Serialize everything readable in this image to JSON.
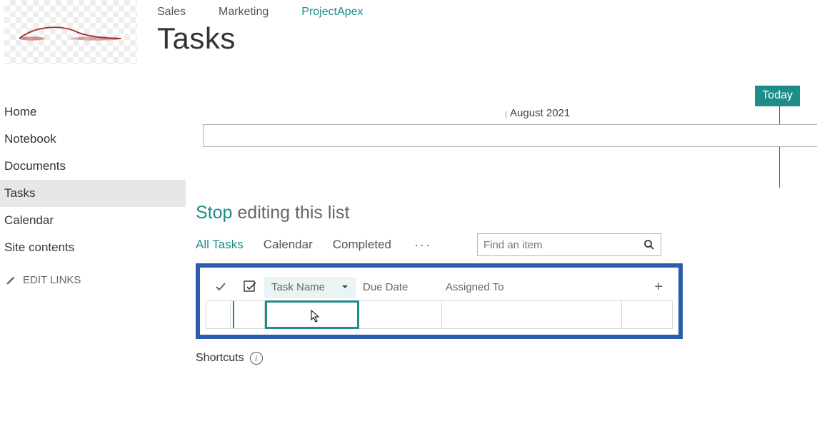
{
  "topnav": {
    "items": [
      {
        "label": "Sales",
        "active": false
      },
      {
        "label": "Marketing",
        "active": false
      },
      {
        "label": "ProjectApex",
        "active": true
      }
    ]
  },
  "page": {
    "title": "Tasks"
  },
  "sidebar": {
    "items": [
      {
        "label": "Home",
        "active": false
      },
      {
        "label": "Notebook",
        "active": false
      },
      {
        "label": "Documents",
        "active": false
      },
      {
        "label": "Tasks",
        "active": true
      },
      {
        "label": "Calendar",
        "active": false
      },
      {
        "label": "Site contents",
        "active": false
      }
    ],
    "edit_links_label": "EDIT LINKS"
  },
  "timeline": {
    "today_label": "Today",
    "month_label": "August 2021"
  },
  "list": {
    "stop_word": "Stop",
    "editing_phrase": " editing this list",
    "views": [
      {
        "label": "All Tasks",
        "active": true
      },
      {
        "label": "Calendar",
        "active": false
      },
      {
        "label": "Completed",
        "active": false
      }
    ],
    "more_dots": "···",
    "search_placeholder": "Find an item",
    "columns": {
      "task_name": "Task Name",
      "due_date": "Due Date",
      "assigned_to": "Assigned To"
    },
    "shortcuts_label": "Shortcuts"
  }
}
